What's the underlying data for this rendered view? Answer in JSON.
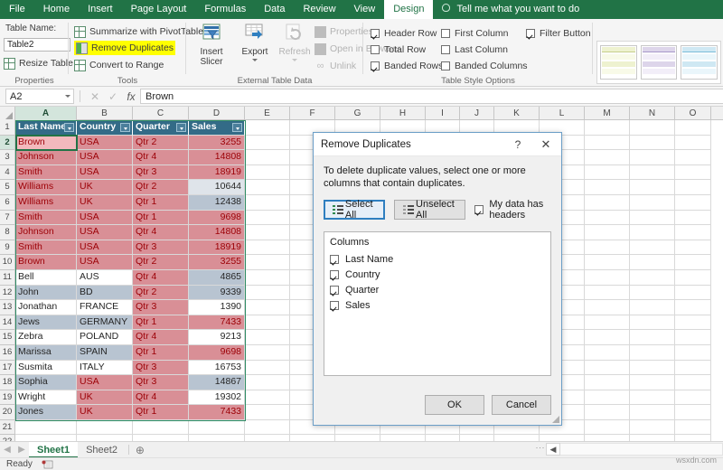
{
  "ribbon": {
    "tabs": [
      {
        "label": "File",
        "active": false
      },
      {
        "label": "Home",
        "active": false
      },
      {
        "label": "Insert",
        "active": false
      },
      {
        "label": "Page Layout",
        "active": false
      },
      {
        "label": "Formulas",
        "active": false
      },
      {
        "label": "Data",
        "active": false
      },
      {
        "label": "Review",
        "active": false
      },
      {
        "label": "View",
        "active": false
      },
      {
        "label": "Design",
        "active": true
      }
    ],
    "tellme": "Tell me what you want to do",
    "groups": {
      "properties": {
        "label": "Properties",
        "table_name_label": "Table Name:",
        "table_name_value": "Table2",
        "resize_table": "Resize Table"
      },
      "tools": {
        "label": "Tools",
        "summarize": "Summarize with PivotTable",
        "remove_duplicates": "Remove Duplicates",
        "convert_to_range": "Convert to Range"
      },
      "external": {
        "label": "External Table Data",
        "insert_slicer_l1": "Insert",
        "insert_slicer_l2": "Slicer",
        "export": "Export",
        "refresh": "Refresh",
        "properties": "Properties",
        "open_in_browser": "Open in Browser",
        "unlink": "Unlink"
      },
      "style_options": {
        "label": "Table Style Options",
        "items": [
          {
            "label": "Header Row",
            "checked": true
          },
          {
            "label": "Total Row",
            "checked": false
          },
          {
            "label": "Banded Rows",
            "checked": true
          },
          {
            "label": "First Column",
            "checked": false
          },
          {
            "label": "Last Column",
            "checked": false
          },
          {
            "label": "Banded Columns",
            "checked": false
          },
          {
            "label": "Filter Button",
            "checked": true
          }
        ]
      }
    }
  },
  "formula_bar": {
    "name_box": "A2",
    "cancel_icon": "✕",
    "enter_icon": "✓",
    "fx_icon": "fx",
    "value": "Brown"
  },
  "grid": {
    "column_headers": [
      "A",
      "B",
      "C",
      "D",
      "E",
      "F",
      "G",
      "H",
      "I",
      "J",
      "K",
      "L",
      "M",
      "N",
      "O"
    ],
    "selected_column": "A",
    "row_headers": [
      "1",
      "2",
      "3",
      "4",
      "5",
      "6",
      "7",
      "8",
      "9",
      "10",
      "11",
      "12",
      "13",
      "14",
      "15",
      "16",
      "17",
      "18",
      "19",
      "20",
      "21",
      "22"
    ],
    "selected_row": "2",
    "table_headers": [
      "Last Name",
      "Country",
      "Quarter",
      "Sales"
    ],
    "rows": [
      {
        "last_name": "Brown",
        "country": "USA",
        "quarter": "Qtr 2",
        "sales": "3255"
      },
      {
        "last_name": "Johnson",
        "country": "USA",
        "quarter": "Qtr 4",
        "sales": "14808"
      },
      {
        "last_name": "Smith",
        "country": "USA",
        "quarter": "Qtr 3",
        "sales": "18919"
      },
      {
        "last_name": "Williams",
        "country": "UK",
        "quarter": "Qtr 2",
        "sales": "10644"
      },
      {
        "last_name": "Williams",
        "country": "UK",
        "quarter": "Qtr 1",
        "sales": "12438"
      },
      {
        "last_name": "Smith",
        "country": "USA",
        "quarter": "Qtr 1",
        "sales": "9698"
      },
      {
        "last_name": "Johnson",
        "country": "USA",
        "quarter": "Qtr 4",
        "sales": "14808"
      },
      {
        "last_name": "Smith",
        "country": "USA",
        "quarter": "Qtr 3",
        "sales": "18919"
      },
      {
        "last_name": "Brown",
        "country": "USA",
        "quarter": "Qtr 2",
        "sales": "3255"
      },
      {
        "last_name": "Bell",
        "country": "AUS",
        "quarter": "Qtr 4",
        "sales": "4865"
      },
      {
        "last_name": "John",
        "country": "BD",
        "quarter": "Qtr 2",
        "sales": "9339"
      },
      {
        "last_name": "Jonathan",
        "country": "FRANCE",
        "quarter": "Qtr 3",
        "sales": "1390"
      },
      {
        "last_name": "Jews",
        "country": "GERMANY",
        "quarter": "Qtr 1",
        "sales": "7433"
      },
      {
        "last_name": "Zebra",
        "country": "POLAND",
        "quarter": "Qtr 4",
        "sales": "9213"
      },
      {
        "last_name": "Marissa",
        "country": "SPAIN",
        "quarter": "Qtr 1",
        "sales": "9698"
      },
      {
        "last_name": "Susmita",
        "country": "ITALY",
        "quarter": "Qtr 3",
        "sales": "16753"
      },
      {
        "last_name": "Sophia",
        "country": "USA",
        "quarter": "Qtr 3",
        "sales": "14867"
      },
      {
        "last_name": "Wright",
        "country": "UK",
        "quarter": "Qtr 4",
        "sales": "19302"
      },
      {
        "last_name": "Jones",
        "country": "UK",
        "quarter": "Qtr 1",
        "sales": "7433"
      }
    ]
  },
  "dialog": {
    "title": "Remove Duplicates",
    "help_icon": "?",
    "close_icon": "✕",
    "description": "To delete duplicate values, select one or more columns that contain duplicates.",
    "select_all": "Select All",
    "unselect_all": "Unselect All",
    "my_data_has_headers": "My data has headers",
    "my_data_has_headers_checked": true,
    "columns_label": "Columns",
    "columns": [
      {
        "label": "Last Name",
        "checked": true
      },
      {
        "label": "Country",
        "checked": true
      },
      {
        "label": "Quarter",
        "checked": true
      },
      {
        "label": "Sales",
        "checked": true
      }
    ],
    "ok": "OK",
    "cancel": "Cancel"
  },
  "sheet_bar": {
    "prev_icon": "◀",
    "next_icon": "▶",
    "tabs": [
      {
        "label": "Sheet1",
        "active": true
      },
      {
        "label": "Sheet2",
        "active": false
      }
    ],
    "add_icon": "⊕",
    "scroll_left_icon": "◀"
  },
  "status_bar": {
    "text": "Ready",
    "watermark": "wsxdn.com"
  },
  "colors": {
    "accent_green": "#217346",
    "table_header_blue": "#336b87",
    "dup_pink": "#f3b9bd",
    "dup_red": "#d98f96",
    "band_blue": "#b8c4d1",
    "highlight_yellow": "#ffff00"
  }
}
